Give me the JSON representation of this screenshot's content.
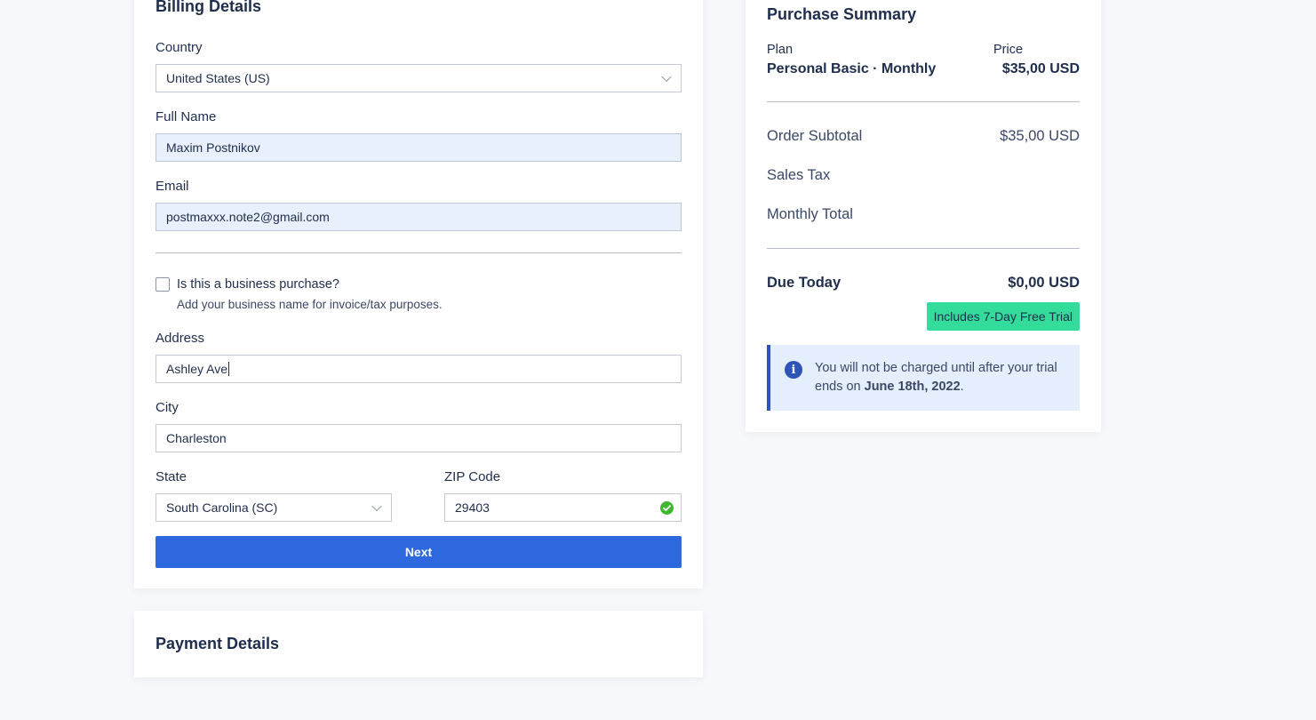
{
  "billing": {
    "title": "Billing Details",
    "country_label": "Country",
    "country_value": "United States (US)",
    "full_name_label": "Full Name",
    "full_name_value": "Maxim Postnikov",
    "email_label": "Email",
    "email_value": "postmaxxx.note2@gmail.com",
    "business_question": "Is this a business purchase?",
    "business_hint": "Add your business name for invoice/tax purposes.",
    "address_label": "Address",
    "address_value": "Ashley Ave",
    "city_label": "City",
    "city_value": "Charleston",
    "state_label": "State",
    "state_value": "South Carolina (SC)",
    "zip_label": "ZIP Code",
    "zip_value": "29403",
    "next_label": "Next"
  },
  "payment": {
    "title": "Payment Details"
  },
  "summary": {
    "title": "Purchase Summary",
    "plan_label": "Plan",
    "plan_value": "Personal Basic · Monthly",
    "price_label": "Price",
    "price_value": "$35,00 USD",
    "subtotal_label": "Order Subtotal",
    "subtotal_value": "$35,00 USD",
    "tax_label": "Sales Tax",
    "monthly_total_label": "Monthly Total",
    "due_today_label": "Due Today",
    "due_today_value": "$0,00 USD",
    "trial_badge": "Includes 7-Day Free Trial",
    "notice_text_before": "You will not be charged until after your trial ends on ",
    "notice_date": "June 18th, 2022",
    "notice_text_after": "."
  },
  "colors": {
    "primary_button": "#2d68de",
    "trial_badge": "#33dc9b",
    "notice_background": "#e5eefc",
    "notice_accent": "#2d55b8",
    "valid_check": "#3fb82f"
  },
  "icons": [
    "chevron-down-icon",
    "check-circle-icon",
    "info-icon"
  ]
}
